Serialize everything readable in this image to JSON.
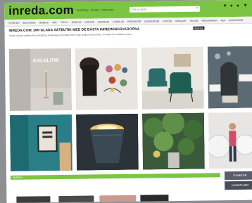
{
  "header": {
    "logo": "inreda.com",
    "tagline": "inredning · design · presenter",
    "search_placeholder": "Sök produkt...",
    "colors": {
      "brand": "#7cc542"
    }
  },
  "nav": {
    "items": [
      "NYHETER",
      "BELYSNING",
      "MÖBLER",
      "KÖK",
      "TEXTIL",
      "BADRUM",
      "KONTOR",
      "BARNRUM",
      "UTEMILJÖ",
      "PRESENTER",
      "DEKORATION",
      "VÄXTER",
      "SPEGLAR",
      "TAVLOR",
      "VARUMÄRKEN",
      "REA",
      "INSPIRATION"
    ]
  },
  "promo": {
    "headline": "INREDA.COM, DIN GLADA SÄTBUTIK MED DE BÄSTA INREDNINGSVARORNA",
    "sub": "Vi har ett brett sortiment av inredning, belysning och möbler från noga utvalda varumärken. Fri frakt och snabb leverans.",
    "payment": "Klarna"
  },
  "tiles": {
    "kalklitir": "KALKLITIR"
  },
  "banner": {
    "label": "Nyheter"
  },
  "side_buttons": [
    "NYHETER",
    "KAMPANJER"
  ]
}
